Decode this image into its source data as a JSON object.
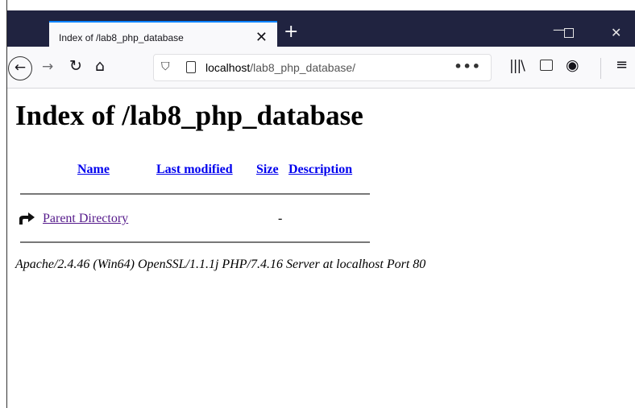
{
  "browser": {
    "tab_title": "Index of /lab8_php_database",
    "tab_close": "✕",
    "new_tab": "+",
    "window_min": "—",
    "window_close": "✕",
    "url_host": "localhost",
    "url_path": "/lab8_php_database/",
    "page_actions": "•••",
    "menu": "≡"
  },
  "page": {
    "heading": "Index of /lab8_php_database",
    "columns": [
      "Name",
      "Last modified",
      "Size",
      "Description"
    ],
    "rows": [
      {
        "name": "Parent Directory",
        "modified": "",
        "size": "-",
        "description": ""
      }
    ],
    "address": "Apache/2.4.46 (Win64) OpenSSL/1.1.1j PHP/7.4.16 Server at localhost Port 80"
  },
  "icons": [
    "back-icon",
    "forward-icon",
    "reload-icon",
    "home-icon",
    "shield-icon",
    "page-icon",
    "library-icon",
    "sidebar-icon",
    "account-icon",
    "menu-icon",
    "parent-directory-icon"
  ],
  "colors": {
    "tab_strip": "#202340",
    "active_tab_accent": "#0a84ff",
    "link": "#0000ee",
    "visited_link": "#551a8b",
    "toolbar": "#f9f9fb"
  }
}
